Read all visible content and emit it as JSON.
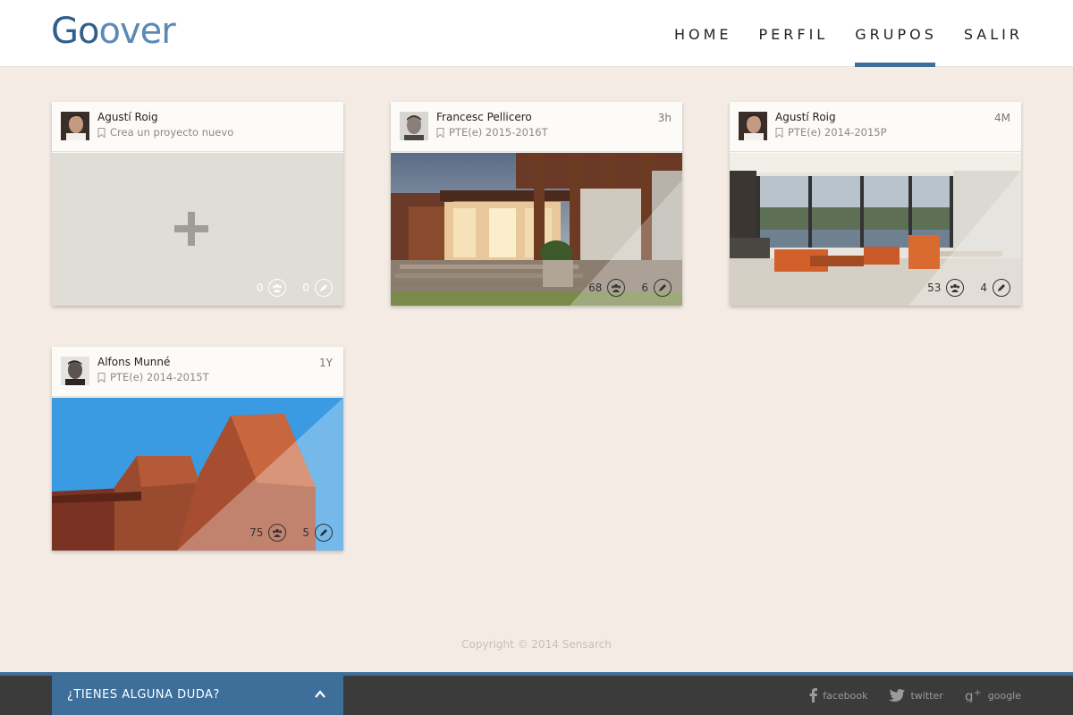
{
  "app": {
    "logo_go": "Go",
    "logo_over": "over"
  },
  "nav": {
    "items": [
      {
        "label": "HOME"
      },
      {
        "label": "PERFIL"
      },
      {
        "label": "GRUPOS",
        "active": true
      },
      {
        "label": "SALIR"
      }
    ]
  },
  "cards": [
    {
      "author": "Agustí Roig",
      "group": "Crea un proyecto nuevo",
      "time": "",
      "members": "0",
      "projects": "0",
      "image": "new-project-placeholder"
    },
    {
      "author": "Francesc Pellicero",
      "group": "PTE(e) 2015-2016T",
      "time": "3h",
      "members": "68",
      "projects": "6",
      "image": "house-exterior-photo"
    },
    {
      "author": "Agustí Roig",
      "group": "PTE(e) 2014-2015P",
      "time": "4M",
      "members": "53",
      "projects": "4",
      "image": "living-room-interior-photo"
    },
    {
      "author": "Alfons Munné",
      "group": "PTE(e) 2014-2015T",
      "time": "1Y",
      "members": "75",
      "projects": "5",
      "image": "brick-building-photo"
    }
  ],
  "footer": {
    "copyright": "Copyright © 2014 Sensarch",
    "help_label": "¿TIENES ALGUNA DUDA?",
    "social": [
      {
        "label": "facebook",
        "icon": "facebook-icon"
      },
      {
        "label": "twitter",
        "icon": "twitter-icon"
      },
      {
        "label": "google",
        "icon": "google-plus-icon"
      }
    ]
  },
  "colors": {
    "accent": "#3d6f9a",
    "background": "#f4ece4",
    "footer": "#3b3b3b"
  }
}
